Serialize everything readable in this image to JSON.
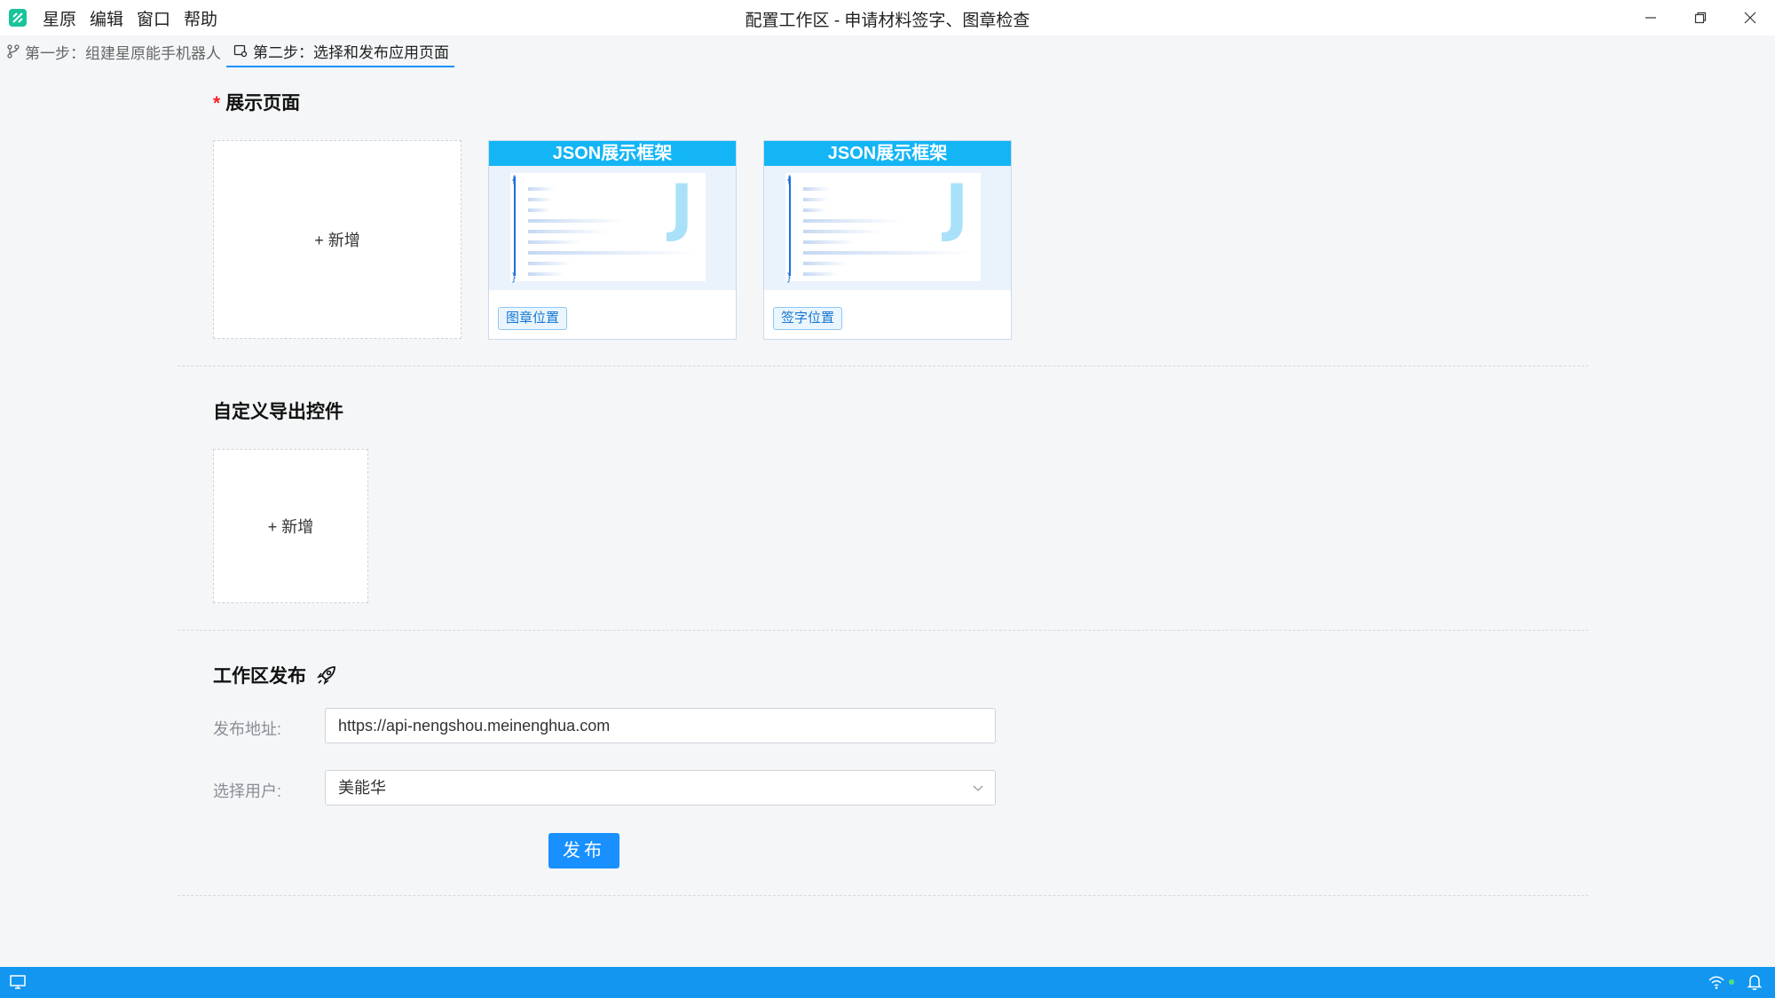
{
  "app": {
    "menu": [
      "星原",
      "编辑",
      "窗口",
      "帮助"
    ],
    "title": "配置工作区 - 申请材料签字、图章检查"
  },
  "tabs": [
    {
      "label": "第一步：组建星原能手机器人",
      "icon": "branch-icon"
    },
    {
      "label": "第二步：选择和发布应用页面",
      "icon": "page-settings-icon",
      "active": true
    }
  ],
  "display_pages": {
    "required_mark": "*",
    "title": "展示页面",
    "add_label": "+ 新增",
    "cards": [
      {
        "header": "JSON展示框架",
        "badge": "图章位置",
        "thumb_glyph": "J",
        "bracket_open": "{",
        "bracket_close": "}"
      },
      {
        "header": "JSON展示框架",
        "badge": "签字位置",
        "thumb_glyph": "J",
        "bracket_open": "{",
        "bracket_close": "}"
      }
    ]
  },
  "export_controls": {
    "title": "自定义导出控件",
    "add_label": "+ 新增"
  },
  "publish": {
    "title": "工作区发布",
    "title_icon": "rocket-icon",
    "address_label": "发布地址:",
    "address_value": "https://api-nengshou.meinenghua.com",
    "user_label": "选择用户:",
    "user_value": "美能华",
    "button_label": "发布"
  },
  "colors": {
    "accent": "#1890ff",
    "statusbar": "#1296f0",
    "card_header": "#13b5f5",
    "required": "#f5222d"
  }
}
